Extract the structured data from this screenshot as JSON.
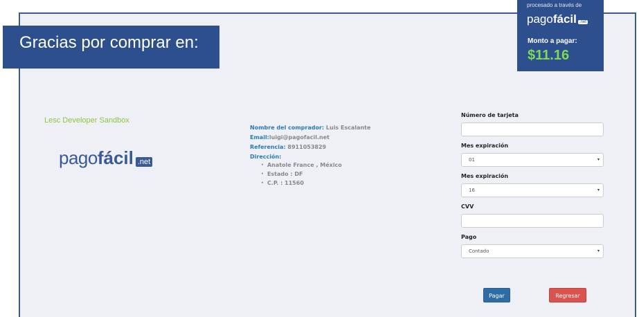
{
  "header": {
    "thanks_text": "Gracias por comprar en:"
  },
  "badge": {
    "processed_via": "procesado a través de",
    "logo_word1": "pago",
    "logo_word2": "fácil",
    "logo_tag": ".net",
    "amount_label": "Monto a pagar:",
    "amount": "$11.16"
  },
  "store": {
    "name": "Lesc Developer Sandbox",
    "logo_word1": "pago",
    "logo_word2": "fácil",
    "logo_tag": ".net"
  },
  "buyer": {
    "name_label": "Nombre del comprador:",
    "name_value": " Luis Escalante",
    "email_label": "Email:",
    "email_value": "luigi@pagofacil.net",
    "reference_label": "Referencia:",
    "reference_value": " 8911053829",
    "address_label": "Dirección:",
    "address_lines": [
      "Anatole France , México",
      "Estado : DF",
      "C.P. : 11560"
    ]
  },
  "form": {
    "card_label": "Número de tarjeta",
    "card_value": "",
    "month_label": "Mes expiración",
    "month_value": "01",
    "year_label": "Mes expiración",
    "year_value": "16",
    "cvv_label": "CVV",
    "cvv_value": "",
    "payment_label": "Pago",
    "payment_value": "Contado",
    "caret": "▾"
  },
  "actions": {
    "pay_label": "Pagar",
    "back_label": "Regresar"
  },
  "colors": {
    "brand_blue": "#2e4f8e",
    "amount_green": "#7ed957",
    "store_green": "#8cc63f",
    "pay_blue": "#2e6da4",
    "back_red": "#d9534f"
  }
}
